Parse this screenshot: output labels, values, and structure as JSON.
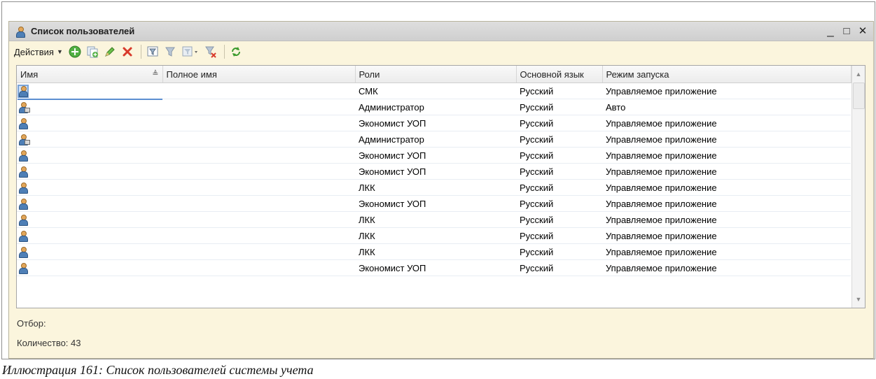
{
  "window": {
    "title": "Список пользователей",
    "controls": {
      "minimize": "_",
      "maximize": "□",
      "close": "✕"
    }
  },
  "toolbar": {
    "actions_label": "Действия",
    "buttons": [
      "add-icon",
      "copy-icon",
      "edit-icon",
      "delete-icon",
      "filter-icon",
      "filter-list-icon",
      "filter-history-icon",
      "clear-filter-icon",
      "refresh-icon"
    ]
  },
  "table": {
    "columns": [
      "Имя",
      "Полное имя",
      "Роли",
      "Основной язык",
      "Режим запуска"
    ],
    "rows": [
      {
        "icon": "user-icon",
        "role": "СМК",
        "lang": "Русский",
        "mode": "Управляемое приложение"
      },
      {
        "icon": "user-admin-icon",
        "role": "Администратор",
        "lang": "Русский",
        "mode": "Авто"
      },
      {
        "icon": "user-icon",
        "role": "Экономист УОП",
        "lang": "Русский",
        "mode": "Управляемое приложение"
      },
      {
        "icon": "user-admin-icon",
        "role": "Администратор",
        "lang": "Русский",
        "mode": "Управляемое приложение"
      },
      {
        "icon": "user-icon",
        "role": "Экономист УОП",
        "lang": "Русский",
        "mode": "Управляемое приложение"
      },
      {
        "icon": "user-icon",
        "role": "Экономист УОП",
        "lang": "Русский",
        "mode": "Управляемое приложение"
      },
      {
        "icon": "user-icon",
        "role": "ЛКК",
        "lang": "Русский",
        "mode": "Управляемое приложение"
      },
      {
        "icon": "user-icon",
        "role": "Экономист УОП",
        "lang": "Русский",
        "mode": "Управляемое приложение"
      },
      {
        "icon": "user-icon",
        "role": "ЛКК",
        "lang": "Русский",
        "mode": "Управляемое приложение"
      },
      {
        "icon": "user-icon",
        "role": "ЛКК",
        "lang": "Русский",
        "mode": "Управляемое приложение"
      },
      {
        "icon": "user-icon",
        "role": "ЛКК",
        "lang": "Русский",
        "mode": "Управляемое приложение"
      },
      {
        "icon": "user-icon",
        "role": "Экономист УОП",
        "lang": "Русский",
        "mode": "Управляемое приложение"
      }
    ]
  },
  "footer": {
    "filter_label": "Отбор:",
    "count_label": "Количество: 43"
  },
  "caption": "Иллюстрация 161: Список пользователей системы учета"
}
